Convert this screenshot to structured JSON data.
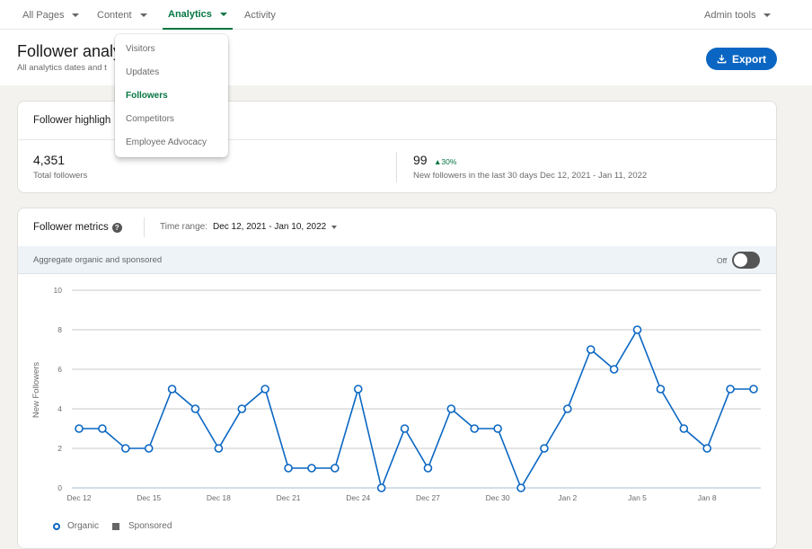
{
  "nav": {
    "items": [
      {
        "label": "All Pages",
        "has_caret": true,
        "active": false
      },
      {
        "label": "Content",
        "has_caret": true,
        "active": false
      },
      {
        "label": "Analytics",
        "has_caret": true,
        "active": true
      },
      {
        "label": "Activity",
        "has_caret": false,
        "active": false
      }
    ],
    "admin_tools": "Admin tools"
  },
  "header": {
    "title": "Follower analy",
    "subtitle": "All analytics dates and t",
    "export_label": "Export"
  },
  "analytics_menu": {
    "items": [
      {
        "label": "Visitors",
        "selected": false
      },
      {
        "label": "Updates",
        "selected": false
      },
      {
        "label": "Followers",
        "selected": true
      },
      {
        "label": "Competitors",
        "selected": false
      },
      {
        "label": "Employee Advocacy",
        "selected": false
      }
    ]
  },
  "highlights": {
    "title": "Follower highligh",
    "total": {
      "value": "4,351",
      "label": "Total followers"
    },
    "new": {
      "value": "99",
      "change": "30%",
      "label": "New followers in the last 30 days Dec 12, 2021 - Jan 11, 2022"
    }
  },
  "metrics": {
    "title": "Follower metrics",
    "help_icon": "?",
    "time_range_label": "Time range:",
    "time_range_value": "Dec 12, 2021 - Jan 10, 2022",
    "aggregate_label": "Aggregate organic and sponsored",
    "toggle_label": "Off",
    "toggle_on": false
  },
  "colors": {
    "accent_green": "#057642",
    "primary_blue": "#0a66c2",
    "series_line": "#0a66c2",
    "sponsored": "#666666"
  },
  "chart_data": {
    "type": "line",
    "title": "",
    "xlabel": "",
    "ylabel": "New Followers",
    "ylim": [
      0,
      10
    ],
    "yticks": [
      0,
      2,
      4,
      6,
      8,
      10
    ],
    "grid": true,
    "legend_position": "bottom-left",
    "x": [
      "Dec 12",
      "Dec 13",
      "Dec 14",
      "Dec 15",
      "Dec 16",
      "Dec 17",
      "Dec 18",
      "Dec 19",
      "Dec 20",
      "Dec 21",
      "Dec 22",
      "Dec 23",
      "Dec 24",
      "Dec 25",
      "Dec 26",
      "Dec 27",
      "Dec 28",
      "Dec 29",
      "Dec 30",
      "Dec 31",
      "Jan 1",
      "Jan 2",
      "Jan 3",
      "Jan 4",
      "Jan 5",
      "Jan 6",
      "Jan 7",
      "Jan 8",
      "Jan 9",
      "Jan 10"
    ],
    "xtick_labels": [
      "Dec 12",
      "Dec 15",
      "Dec 18",
      "Dec 21",
      "Dec 24",
      "Dec 27",
      "Dec 30",
      "Jan 2",
      "Jan 5",
      "Jan 8"
    ],
    "series": [
      {
        "name": "Organic",
        "values": [
          3,
          3,
          2,
          2,
          5,
          4,
          2,
          4,
          5,
          1,
          1,
          1,
          5,
          0,
          3,
          1,
          4,
          3,
          3,
          0,
          2,
          4,
          7,
          6,
          8,
          5,
          3,
          2,
          5,
          5
        ]
      },
      {
        "name": "Sponsored",
        "values": []
      }
    ]
  }
}
